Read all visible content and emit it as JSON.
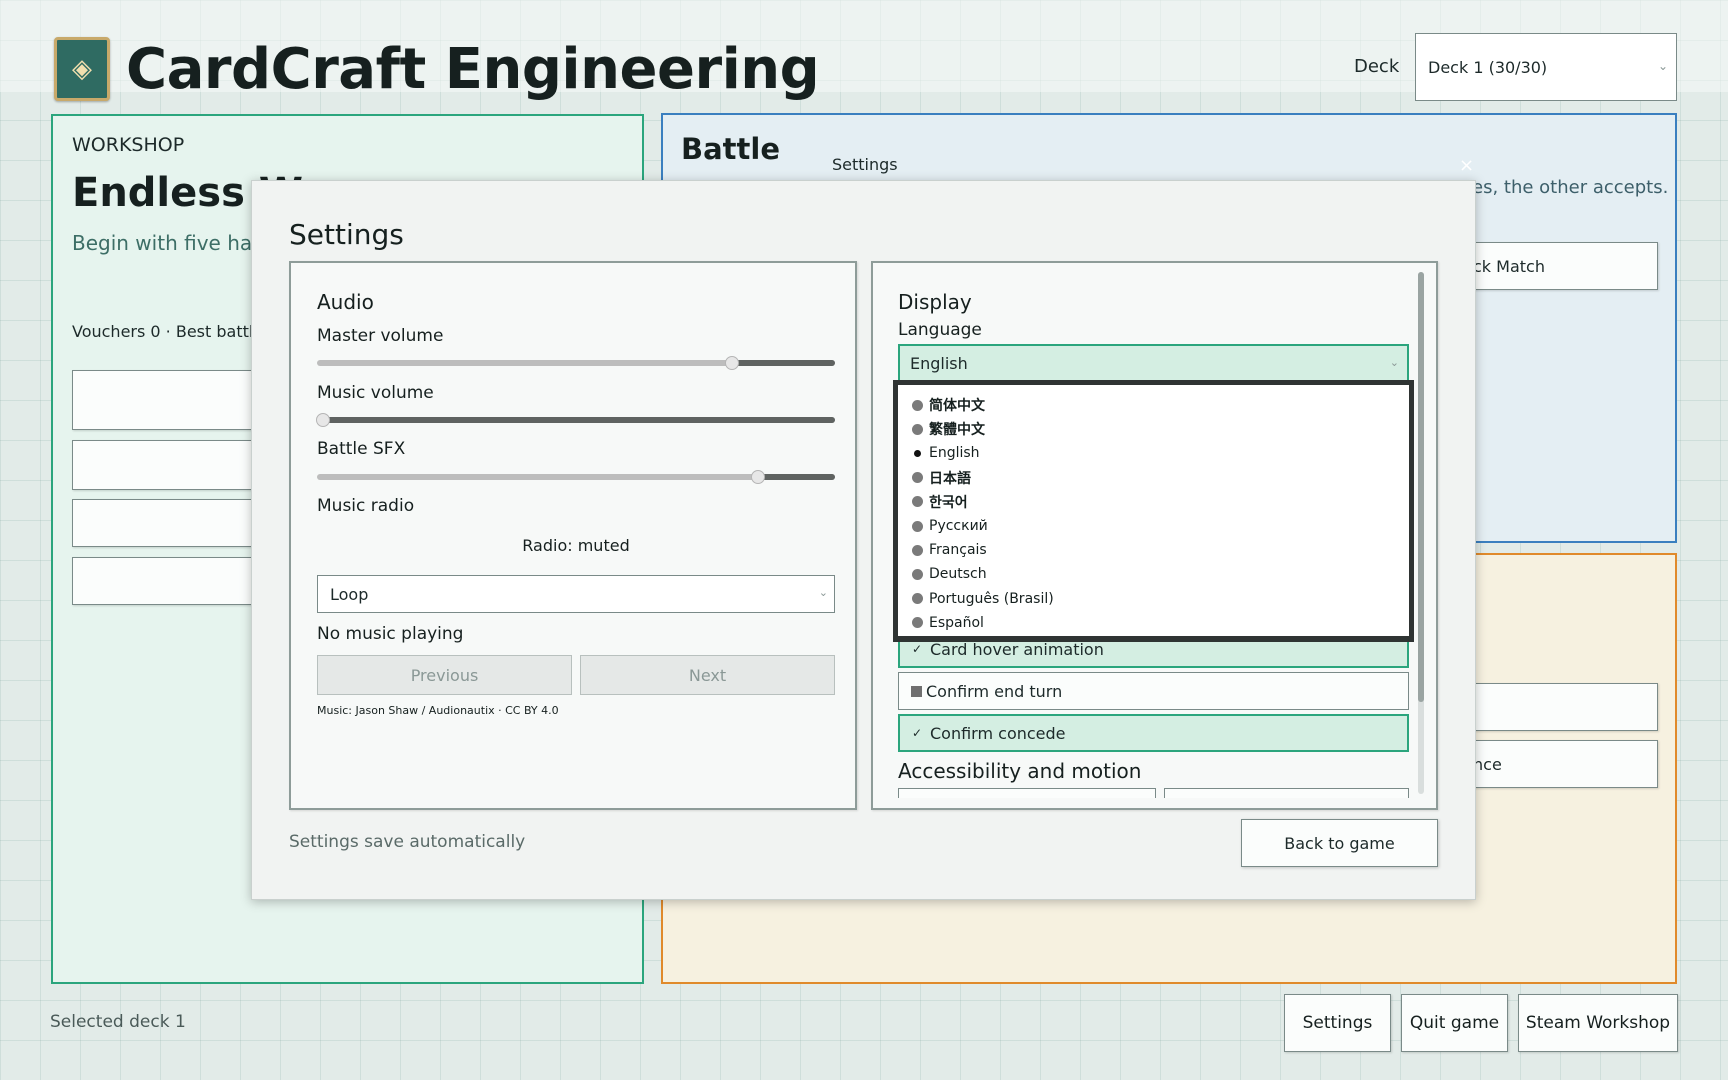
{
  "app": {
    "title": "CardCraft Engineering",
    "deck_label": "Deck",
    "deck_value": "Deck 1 (30/30)"
  },
  "workshop": {
    "eyebrow": "WORKSHOP",
    "title": "Endless W",
    "body": "Begin with five han normal limits.",
    "stats": "Vouchers 0 · Best battle"
  },
  "battle": {
    "title": "Battle",
    "desc": "es, the other accepts.",
    "btn1": "ck Match"
  },
  "third": {
    "btn2": "nce"
  },
  "window": {
    "title": "Settings",
    "close": "×"
  },
  "settings": {
    "title": "Settings",
    "audio": {
      "heading": "Audio",
      "master_label": "Master volume",
      "master_value": 0.8,
      "music_label": "Music volume",
      "music_value": 0.01,
      "sfx_label": "Battle SFX",
      "sfx_value": 0.85,
      "radio_label": "Music radio",
      "radio_status": "Radio: muted",
      "loop_value": "Loop",
      "now_playing": "No music playing",
      "prev": "Previous",
      "next": "Next",
      "credit": "Music: Jason Shaw / Audionautix · CC BY 4.0"
    },
    "display": {
      "heading": "Display",
      "language_label": "Language",
      "language_value": "English",
      "languages": [
        "简体中文",
        "繁體中文",
        "English",
        "日本語",
        "한국어",
        "Русский",
        "Français",
        "Deutsch",
        "Português (Brasil)",
        "Español"
      ],
      "selected_language": "English",
      "toggles": [
        {
          "label": "Card hover animation",
          "on": true
        },
        {
          "label": "Confirm end turn",
          "on": false
        },
        {
          "label": "Confirm concede",
          "on": true
        }
      ],
      "accessibility_heading": "Accessibility and motion"
    },
    "save_note": "Settings save automatically",
    "back": "Back to game"
  },
  "footer": {
    "selected_deck": "Selected deck 1",
    "settings": "Settings",
    "quit": "Quit game",
    "workshop": "Steam Workshop"
  },
  "colors": {
    "accent_green": "#2ba57d",
    "battle_blue": "#3a7fbf",
    "orange": "#e08a2b"
  }
}
